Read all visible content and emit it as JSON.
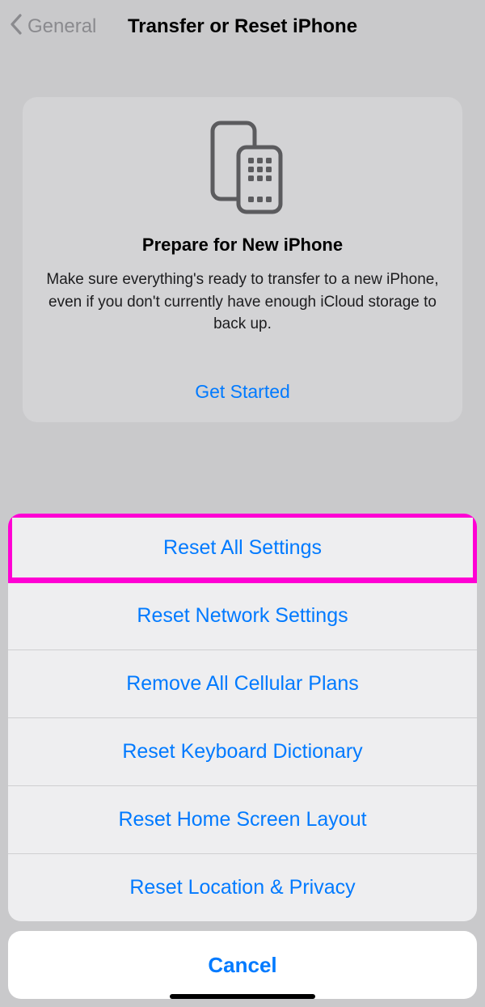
{
  "header": {
    "back_label": "General",
    "title": "Transfer or Reset iPhone"
  },
  "card": {
    "heading": "Prepare for New iPhone",
    "body": "Make sure everything's ready to transfer to a new iPhone, even if you don't currently have enough iCloud storage to back up.",
    "cta": "Get Started"
  },
  "sheet": {
    "items": [
      "Reset All Settings",
      "Reset Network Settings",
      "Remove All Cellular Plans",
      "Reset Keyboard Dictionary",
      "Reset Home Screen Layout",
      "Reset Location & Privacy"
    ],
    "cancel": "Cancel"
  },
  "highlight_index": 0
}
